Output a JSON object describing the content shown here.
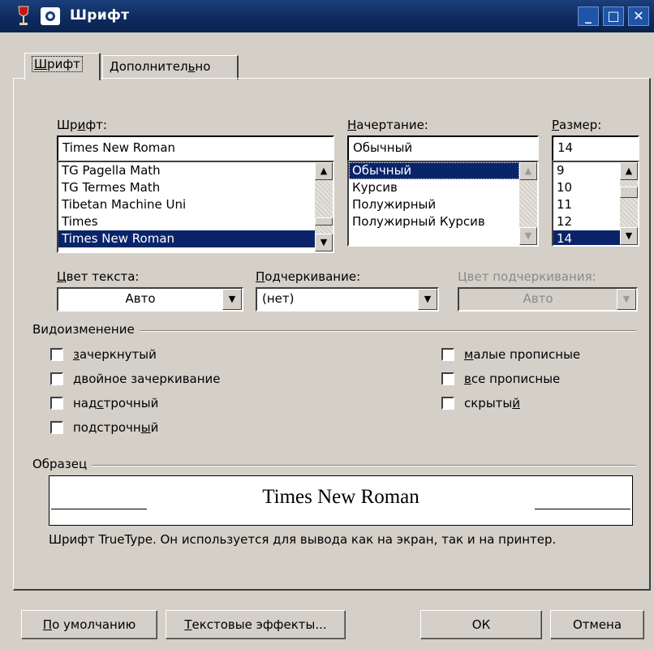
{
  "window": {
    "title": "Шрифт",
    "minimize": "_",
    "maximize": "□",
    "close": "✕"
  },
  "tabs": [
    {
      "pre": "",
      "u": "Ш",
      "post": "рифт"
    },
    {
      "pre": "Дополнител",
      "u": "ь",
      "post": "но"
    }
  ],
  "font": {
    "label_pre": "Шр",
    "label_u": "и",
    "label_post": "фт:",
    "value": "Times New Roman",
    "items": [
      "TG Pagella Math",
      "TG Termes Math",
      "Tibetan Machine Uni",
      "Times",
      "Times New Roman"
    ]
  },
  "style": {
    "label_u": "Н",
    "label_post": "ачертание:",
    "value": "Обычный",
    "items": [
      "Обычный",
      "Курсив",
      "Полужирный",
      "Полужирный Курсив"
    ]
  },
  "size": {
    "label_u": "Р",
    "label_post": "азмер:",
    "value": "14",
    "items": [
      "9",
      "10",
      "11",
      "12",
      "14"
    ]
  },
  "color": {
    "label_u": "Ц",
    "label_post": "вет текста:",
    "value": "Авто"
  },
  "underline": {
    "label_u": "П",
    "label_post": "одчеркивание:",
    "value": "(нет)"
  },
  "underline_color": {
    "label": "Цвет подчеркивания:",
    "value": "Авто"
  },
  "effects": {
    "group_label": "Видоизменение",
    "left": [
      {
        "pre": "",
        "u": "з",
        "post": "ачеркнутый"
      },
      {
        "pre": "",
        "u": "д",
        "post": "войное зачеркивание"
      },
      {
        "pre": "над",
        "u": "с",
        "post": "трочный"
      },
      {
        "pre": "подстрочн",
        "u": "ы",
        "post": "й"
      }
    ],
    "right": [
      {
        "pre": "",
        "u": "м",
        "post": "алые прописные"
      },
      {
        "pre": "",
        "u": "в",
        "post": "се прописные"
      },
      {
        "pre": "скрыты",
        "u": "й",
        "post": ""
      }
    ]
  },
  "sample": {
    "group_label": "Образец",
    "text": "Times New Roman",
    "description": "Шрифт TrueType. Он используется для вывода как на экран, так и на принтер."
  },
  "buttons": {
    "default": {
      "u": "П",
      "post": "о умолчанию"
    },
    "effects": {
      "u": "Т",
      "post": "екстовые эффекты..."
    },
    "ok": "ОК",
    "cancel": "Отмена"
  },
  "icons": {
    "app": "wine-glass-icon",
    "dialog": "font-dialog-icon",
    "scroll_up": "▲",
    "scroll_down": "▼"
  }
}
